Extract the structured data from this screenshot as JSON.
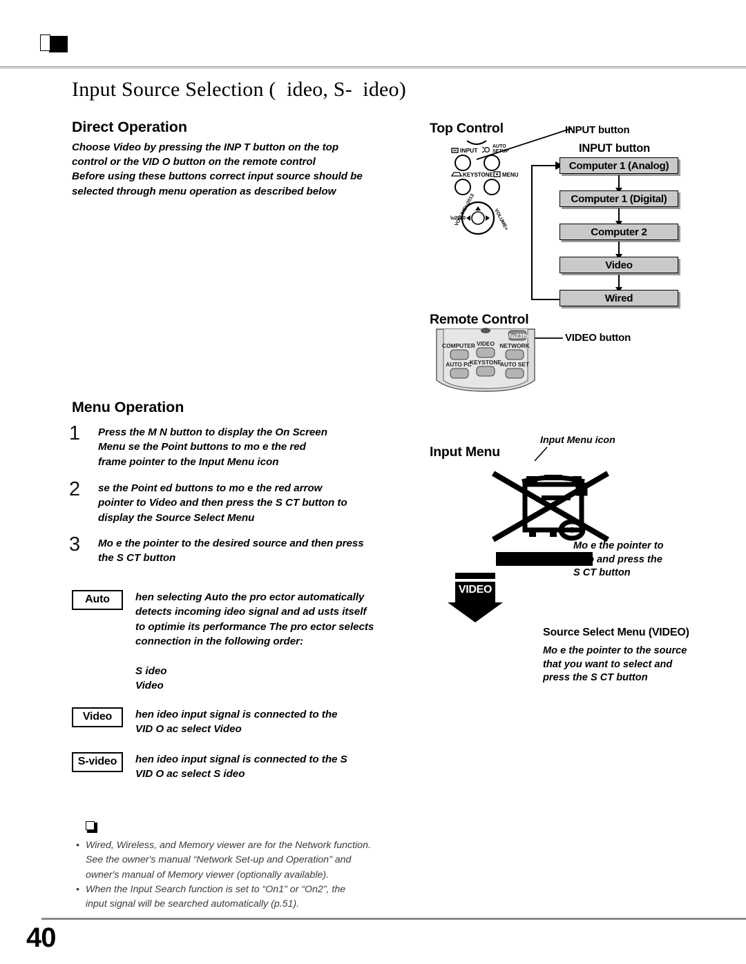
{
  "page": {
    "number": "40",
    "title": "Input Source Selection (  ideo, S-  ideo)"
  },
  "left_column": {
    "direct_operation": {
      "heading": "Direct Operation",
      "body": "Choose Video by pressing the INP  T button on the top\ncontrol or the VID  O button on the remote control\nBefore using these buttons  correct input source should be\nselected through menu operation as described below"
    },
    "menu_operation": {
      "heading": "Menu Operation",
      "steps": [
        {
          "number": "1",
          "text": "Press the M  N   button to display the On Screen\nMenu    se the Point         buttons to mo  e the red\nframe pointer to the Input Menu icon"
        },
        {
          "number": "2",
          "text": "  se the Point  ed   buttons to mo  e the red arrow\npointer to Video and then press the S     CT button to\ndisplay the Source Select Menu"
        },
        {
          "number": "3",
          "text": "Mo  e the pointer to the desired source and then press\nthe S     CT button"
        }
      ]
    },
    "terms": [
      {
        "label": "Auto",
        "text": "  hen selecting Auto  the pro ector automatically\ndetects incoming   ideo signal  and ad usts itself\nto optimie its performance  The pro ector selects\nconnection in the following order:",
        "sub_list": "S   ideo\nVideo"
      },
      {
        "label": "Video",
        "text": "  hen   ideo input signal is connected to the\nVID  O  ac   select Video"
      },
      {
        "label": "S-video",
        "text": "  hen   ideo input signal is connected to the S\nVID  O  ac   select S   ideo"
      }
    ],
    "notes": [
      "Wired, Wireless, and Memory viewer are for the Network function.\nSee the owner's manual “Network Set-up and Operation” and\nowner's manual of Memory viewer (optionally available).",
      "When the Input Search function is set to “On1” or “On2”, the\ninput signal will be searched automatically (p.51)."
    ]
  },
  "right_column": {
    "top_control": {
      "heading": "Top Control",
      "callout": "INPUT button",
      "buttons": [
        {
          "label": "INPUT",
          "icon": "input-icon"
        },
        {
          "label": "AUTO SETUP",
          "icon": "auto-setup-icon"
        },
        {
          "label": "KEYSTONE",
          "icon": "keystone-icon"
        },
        {
          "label": "MENU",
          "icon": "menu-icon"
        }
      ],
      "dial": {
        "left_label": "VOLUME–",
        "right_label": "VOLUME+"
      }
    },
    "flowchart": {
      "heading": "INPUT button",
      "items": [
        "Computer 1 (Analog)",
        "Computer 1 (Digital)",
        "Computer 2",
        "Video",
        "Wired"
      ]
    },
    "remote_control": {
      "heading": "Remote Control",
      "callout": "VIDEO button",
      "buttons": [
        {
          "label": "COMPUTER",
          "icon": "computer-icon"
        },
        {
          "label": "VIDEO",
          "icon": "video-icon"
        },
        {
          "label": "NETWORK",
          "icon": "network-icon"
        },
        {
          "label": "AUTO PC",
          "icon": "auto-pc-icon"
        },
        {
          "label": "KEYSTONE",
          "icon": "keystone-icon"
        },
        {
          "label": "AUTO SET",
          "icon": "auto-set-icon"
        }
      ],
      "power_label": "I/⏻"
    },
    "input_menu": {
      "heading": "Input Menu",
      "icon_label": "Input Menu icon",
      "annotation": "Mo  e the pointer to\n  ideo and press the\nS     CT button"
    },
    "video_arrow": {
      "label": "VIDEO"
    },
    "source_select": {
      "caption": "Source Select Menu (VIDEO)",
      "annotation": "Mo  e the pointer to the source\nthat you want to select and\npress the S     CT button"
    }
  },
  "colors": {
    "flow_box_fill": "#c9c9c9",
    "flow_box_shadow": "#9a9a9a",
    "rule": "#8a8a8a",
    "note_text": "#3a3a3a",
    "remote_body": "#d8d8d8"
  }
}
